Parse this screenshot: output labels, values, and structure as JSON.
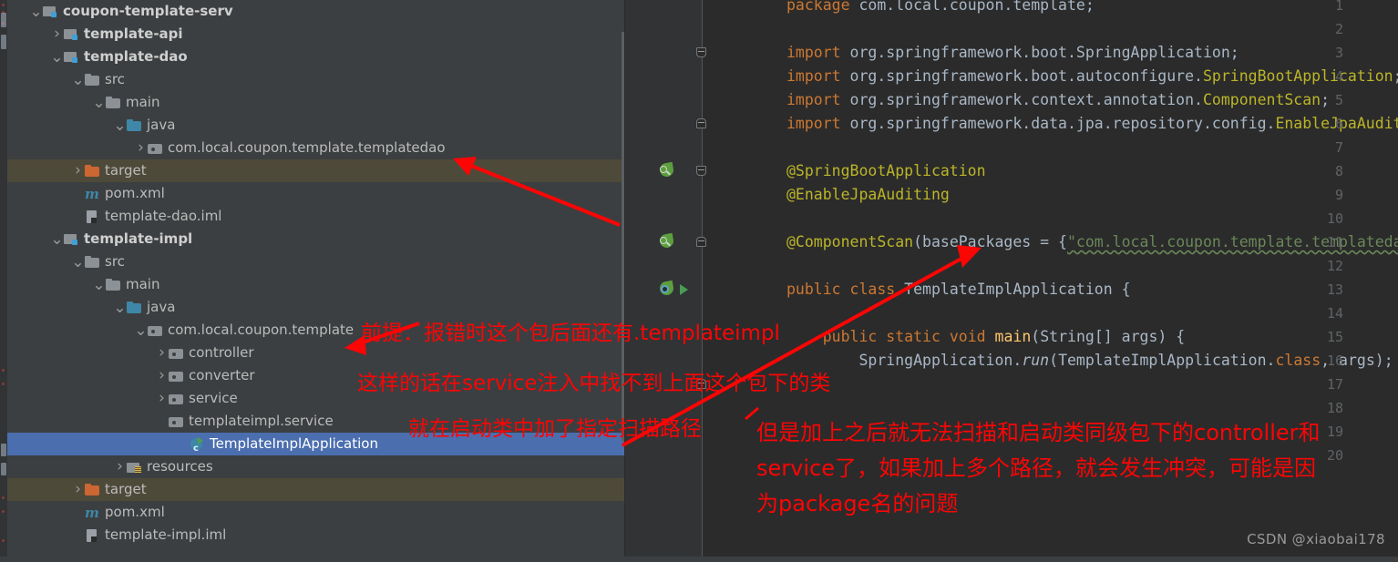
{
  "window": {
    "theme": "darcula",
    "accent_selection": "#4b6eaf",
    "annotation_color": "#fc0505",
    "watermark": "CSDN @xiaobai178"
  },
  "project_tree": {
    "name": "Project tool window",
    "items": [
      {
        "label": "coupon-template-serv",
        "icon": "module-folder-icon",
        "indent": 0,
        "twisty": "expanded",
        "style": "module",
        "state": "normal"
      },
      {
        "label": "template-api",
        "icon": "module-folder-icon",
        "indent": 1,
        "twisty": "collapsed",
        "style": "module",
        "state": "normal"
      },
      {
        "label": "template-dao",
        "icon": "module-folder-icon",
        "indent": 1,
        "twisty": "expanded",
        "style": "module",
        "state": "normal"
      },
      {
        "label": "src",
        "icon": "folder-icon",
        "indent": 2,
        "twisty": "expanded",
        "style": "plain",
        "state": "normal"
      },
      {
        "label": "main",
        "icon": "folder-icon",
        "indent": 3,
        "twisty": "expanded",
        "style": "plain",
        "state": "normal"
      },
      {
        "label": "java",
        "icon": "source-folder-icon",
        "indent": 4,
        "twisty": "expanded",
        "style": "plain",
        "state": "normal"
      },
      {
        "label": "com.local.coupon.template.templatedao",
        "icon": "package-icon",
        "indent": 5,
        "twisty": "collapsed",
        "style": "plain",
        "state": "normal"
      },
      {
        "label": "target",
        "icon": "excluded-folder-icon",
        "indent": 2,
        "twisty": "collapsed",
        "style": "plain",
        "state": "excluded"
      },
      {
        "label": "pom.xml",
        "icon": "maven-icon",
        "indent": 2,
        "twisty": "none",
        "style": "plain",
        "state": "normal"
      },
      {
        "label": "template-dao.iml",
        "icon": "iml-file-icon",
        "indent": 2,
        "twisty": "none",
        "style": "plain",
        "state": "normal"
      },
      {
        "label": "template-impl",
        "icon": "module-folder-icon",
        "indent": 1,
        "twisty": "expanded",
        "style": "module",
        "state": "normal"
      },
      {
        "label": "src",
        "icon": "folder-icon",
        "indent": 2,
        "twisty": "expanded",
        "style": "plain",
        "state": "normal"
      },
      {
        "label": "main",
        "icon": "folder-icon",
        "indent": 3,
        "twisty": "expanded",
        "style": "plain",
        "state": "normal"
      },
      {
        "label": "java",
        "icon": "source-folder-icon",
        "indent": 4,
        "twisty": "expanded",
        "style": "plain",
        "state": "normal"
      },
      {
        "label": "com.local.coupon.template",
        "icon": "package-icon",
        "indent": 5,
        "twisty": "expanded",
        "style": "plain",
        "state": "normal"
      },
      {
        "label": "controller",
        "icon": "package-icon",
        "indent": 6,
        "twisty": "collapsed",
        "style": "plain",
        "state": "normal"
      },
      {
        "label": "converter",
        "icon": "package-icon",
        "indent": 6,
        "twisty": "collapsed",
        "style": "plain",
        "state": "normal"
      },
      {
        "label": "service",
        "icon": "package-icon",
        "indent": 6,
        "twisty": "collapsed",
        "style": "plain",
        "state": "normal"
      },
      {
        "label": "templateimpl.service",
        "icon": "package-icon",
        "indent": 6,
        "twisty": "none",
        "style": "plain",
        "state": "normal"
      },
      {
        "label": "TemplateImplApplication",
        "icon": "java-class-runnable-icon",
        "indent": 7,
        "twisty": "none",
        "style": "plain",
        "state": "selected"
      },
      {
        "label": "resources",
        "icon": "resources-folder-icon",
        "indent": 4,
        "twisty": "collapsed",
        "style": "plain",
        "state": "normal"
      },
      {
        "label": "target",
        "icon": "excluded-folder-icon",
        "indent": 2,
        "twisty": "collapsed",
        "style": "plain",
        "state": "excluded"
      },
      {
        "label": "pom.xml",
        "icon": "maven-icon",
        "indent": 2,
        "twisty": "none",
        "style": "plain",
        "state": "normal"
      },
      {
        "label": "template-impl.iml",
        "icon": "iml-file-icon",
        "indent": 2,
        "twisty": "none",
        "style": "plain",
        "state": "normal"
      }
    ]
  },
  "editor": {
    "file": "TemplateImplApplication",
    "lines": [
      {
        "n": "1",
        "gutter": "",
        "fold": "",
        "html": "<span class=\"k\">package</span> <span class=\"p\">com.local.coupon.template;</span>"
      },
      {
        "n": "2",
        "gutter": "",
        "fold": "",
        "html": ""
      },
      {
        "n": "3",
        "gutter": "",
        "fold": "start",
        "html": "<span class=\"k\">import</span> <span class=\"p\">org.springframework.boot.</span><span class=\"cls\">SpringApplication</span><span class=\"p\">;</span>"
      },
      {
        "n": "4",
        "gutter": "",
        "fold": "",
        "html": "<span class=\"k\">import</span> <span class=\"p\">org.springframework.boot.autoconfigure.</span><span class=\"ann\">SpringBootApplication</span><span class=\"p\">;</span>"
      },
      {
        "n": "5",
        "gutter": "",
        "fold": "",
        "html": "<span class=\"k\">import</span> <span class=\"p\">org.springframework.context.annotation.</span><span class=\"ann\">ComponentScan</span><span class=\"p\">;</span>"
      },
      {
        "n": "6",
        "gutter": "",
        "fold": "end",
        "html": "<span class=\"k\">import</span> <span class=\"p\">org.springframework.data.jpa.repository.config.</span><span class=\"ann\">EnableJpaAuditing</span><span class=\"p\">;</span>"
      },
      {
        "n": "7",
        "gutter": "",
        "fold": "",
        "html": ""
      },
      {
        "n": "8",
        "gutter": "spring-bean-icon",
        "fold": "start",
        "html": "<span class=\"ann\">@SpringBootApplication</span>"
      },
      {
        "n": "9",
        "gutter": "",
        "fold": "",
        "html": "<span class=\"ann\">@EnableJpaAuditing</span>"
      },
      {
        "n": "10",
        "gutter": "",
        "fold": "",
        "html": ""
      },
      {
        "n": "11",
        "gutter": "spring-bean-icon",
        "fold": "end",
        "html": "<span class=\"ann\">@ComponentScan</span><span class=\"p\">(</span><span class=\"id\">basePackages</span> <span class=\"p\">= {</span><span class=\"str under\">\"com.local.coupon.template.templatedao\"</span><span class=\"p\">})</span>"
      },
      {
        "n": "12",
        "gutter": "",
        "fold": "",
        "html": ""
      },
      {
        "n": "13",
        "gutter": "spring-config-icon",
        "run": true,
        "fold": "",
        "html": "<span class=\"k\">public</span> <span class=\"k\">class</span> <span class=\"cls\">TemplateImplApplication</span> <span class=\"p\">{</span>"
      },
      {
        "n": "14",
        "gutter": "",
        "fold": "",
        "html": ""
      },
      {
        "n": "15",
        "gutter": "",
        "fold": "",
        "html": "    <span class=\"k\">public</span> <span class=\"k\">static</span> <span class=\"k\">void</span> <span class=\"fn\">main</span><span class=\"p\">(</span><span class=\"cls\">String</span><span class=\"p\">[] </span><span class=\"id\">args</span><span class=\"p\">) {</span>"
      },
      {
        "n": "16",
        "gutter": "",
        "fold": "",
        "html": "        <span class=\"cls\">SpringApplication</span><span class=\"p\">.</span><span class=\"it\">run</span><span class=\"p\">(</span><span class=\"cls\">TemplateImplApplication</span><span class=\"p\">.</span><span class=\"k\">class</span><span class=\"p\">, </span><span class=\"id\">args</span><span class=\"p\">);</span>"
      },
      {
        "n": "17",
        "gutter": "",
        "fold": "end",
        "html": ""
      },
      {
        "n": "18",
        "gutter": "",
        "fold": "",
        "html": ""
      },
      {
        "n": "19",
        "gutter": "",
        "fold": "",
        "html": ""
      },
      {
        "n": "20",
        "gutter": "",
        "fold": "",
        "html": ""
      }
    ]
  },
  "annotations": [
    {
      "id": "note-1",
      "text": "前提：报错时这个包后面还有.templateimpl"
    },
    {
      "id": "note-2",
      "text": "这样的话在service注入中找不到上面这个包下的类"
    },
    {
      "id": "note-3",
      "text": "就在启动类中加了指定扫描路径"
    },
    {
      "id": "note-4-line1",
      "text": "但是加上之后就无法扫描和启动类同级包下的controller和"
    },
    {
      "id": "note-4-line2",
      "text": "service了，如果加上多个路径，就会发生冲突，可能是因"
    },
    {
      "id": "note-4-line3",
      "text": "为package名的问题"
    }
  ]
}
